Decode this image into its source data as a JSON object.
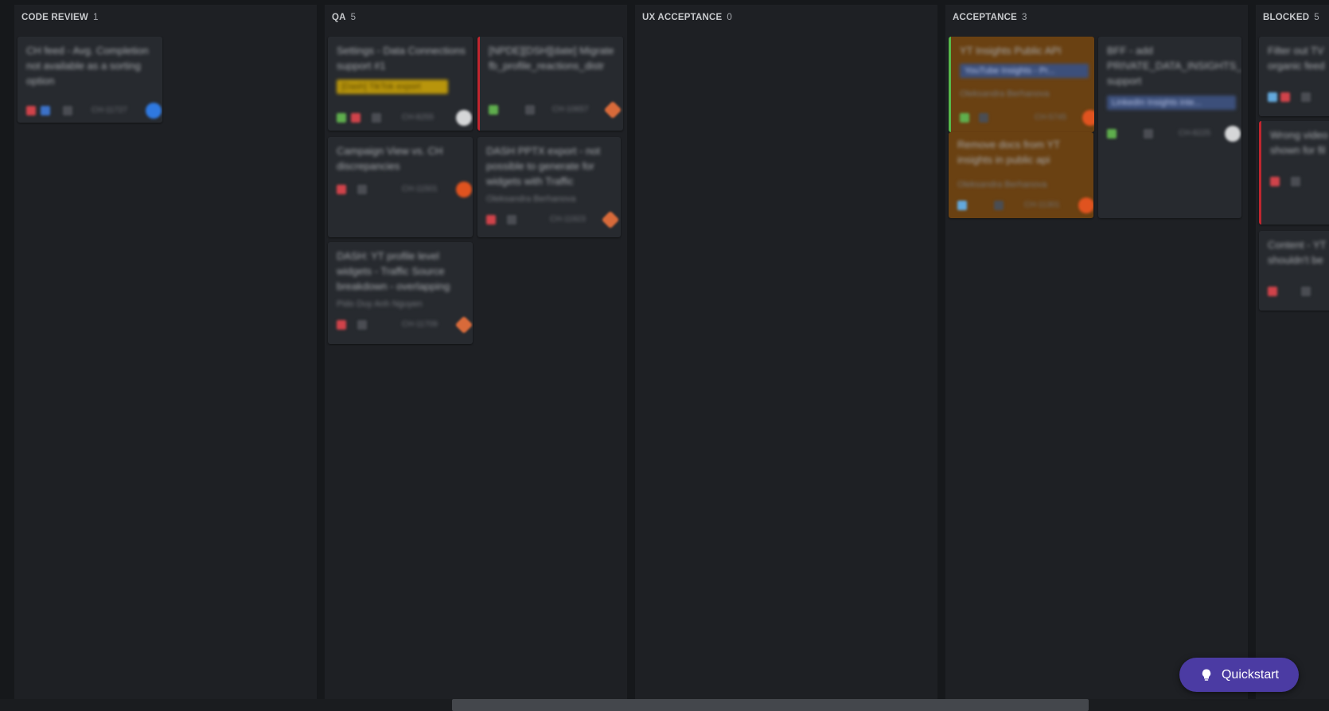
{
  "columns": [
    {
      "title": "CODE REVIEW",
      "count": "1"
    },
    {
      "title": "QA",
      "count": "5"
    },
    {
      "title": "UX ACCEPTANCE",
      "count": "0"
    },
    {
      "title": "ACCEPTANCE",
      "count": "3"
    },
    {
      "title": "BLOCKED",
      "count": "5"
    }
  ],
  "cards": {
    "cr1": {
      "title": "CH feed - Avg. Completion not available as a sorting option",
      "key": "CH-11727"
    },
    "qa1": {
      "title": "Settings - Data Connections support #1",
      "tag": "[Dash] TikTok export",
      "key": "CH-8255"
    },
    "qa2": {
      "title": "[NPDE][DSH][date] Migrate fb_profile_reactions_distr",
      "key": "CH-10657"
    },
    "qa3": {
      "title": "Campaign View vs. CH discrepancies",
      "key": "CH-11501"
    },
    "qa4": {
      "title": "DASH PPTX export - not possible to generate for widgets with Traffic",
      "assignee": "Oleksandra Berhanova",
      "key": "CH-11923"
    },
    "qa5": {
      "title": "DASH: YT profile level widgets - Traffic Source breakdown - overlapping",
      "assignee": "Pido Duy Anh Nguyen",
      "key": "CH-11709"
    },
    "ac1": {
      "title": "YT Insights Public API",
      "tag": "YouTube Insights - Pr...",
      "assignee": "Oleksandra Berhanova",
      "key": "CH-5745"
    },
    "ac2": {
      "title": "Remove docs from YT insights in public api",
      "assignee": "Oleksandra Berhanova",
      "key": "CH-11301"
    },
    "ac3": {
      "title": "BFF - add PRIVATE_DATA_INSIGHTS_ support",
      "tag": "LinkedIn Insights inte...",
      "key": "CH-8225"
    },
    "bl1": {
      "title": "Filter out TV organic feed"
    },
    "bl2": {
      "title": "Wrong video shown for fil"
    },
    "bl3": {
      "title": "Content - YT shouldn't be"
    }
  },
  "quickstart": {
    "label": "Quickstart",
    "icon": "lightbulb-icon"
  },
  "colors": {
    "accent": "#4b3ba3",
    "card_bg": "#272a2f",
    "column_bg": "#1e2024",
    "red": "#c0262f",
    "orange": "#6a4112"
  }
}
